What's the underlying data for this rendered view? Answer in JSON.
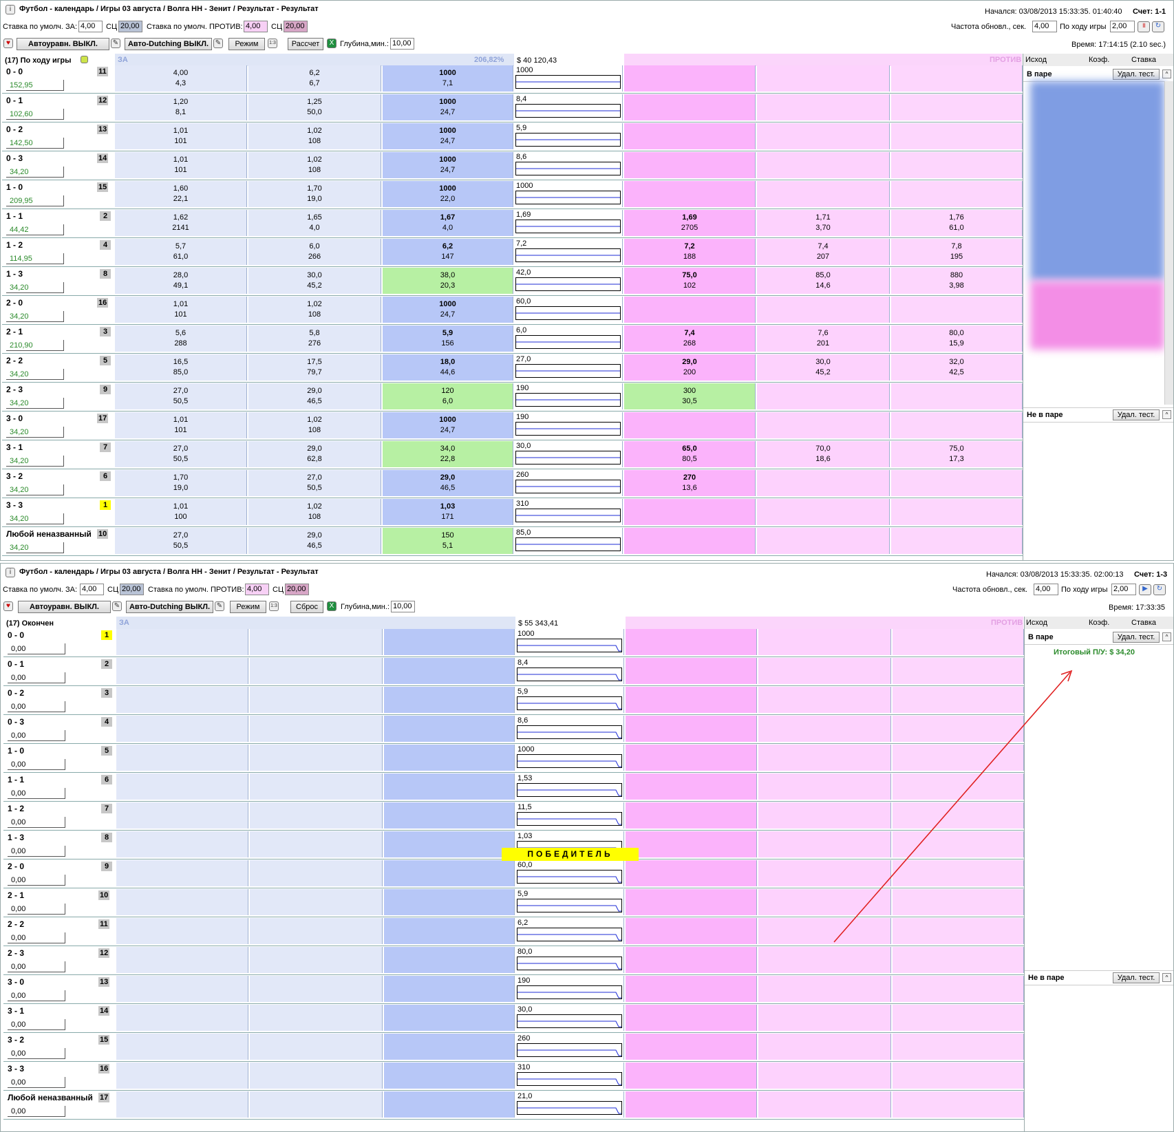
{
  "top": {
    "title": "Футбол - календарь / Игры 03 августа / Волга НН - Зенит / Результат - Результат",
    "started": "Начался: 03/08/2013 15:33:35. 01:40:40",
    "score": "Счет: 1-1",
    "stake_back_label": "Ставка по умолч. ЗА:",
    "stake_back": "4,00",
    "sc1_label": "СЦ",
    "sc1": "20,00",
    "stake_lay_label": "Ставка по умолч. ПРОТИВ:",
    "stake_lay": "4,00",
    "sc2_label": "СЦ",
    "sc2": "20,00",
    "refresh_label": "Частота обновл., сек.",
    "refresh": "4,00",
    "inplay_label": "По ходу игры",
    "inplay": "2,00",
    "auto_eq": "Автоуравн. ВЫКЛ.",
    "auto_dutch": "Авто-Dutching ВЫКЛ.",
    "mode": "Режим",
    "calc": "Рассчет",
    "depth_label": "Глубина,мин.:",
    "depth": "10,00",
    "time": "Время: 17:14:15 (2.10 sec.)",
    "market_name": "(17) По ходу игры",
    "za": "ЗА",
    "pct": "206,82%",
    "money": "$ 40 120,43",
    "protiv": "ПРОТИВ",
    "side_outcome": "Исход",
    "side_coef": "Коэф.",
    "side_stake": "Ставка",
    "matched": "В паре",
    "unmatched": "Не в паре",
    "del_btn": "Удал. тест.",
    "rows": [
      {
        "name": "0 - 0",
        "num": "11",
        "pl": "152,95",
        "b1": [
          "4,00",
          "4,3"
        ],
        "b2": [
          "6,2",
          "6,7"
        ],
        "b3": [
          "1000",
          "7,1"
        ],
        "ch": "1000",
        "l1": [
          "",
          ""
        ],
        "l2": [
          "",
          ""
        ],
        "l3": [
          "",
          ""
        ],
        "hl": false
      },
      {
        "name": "0 - 1",
        "num": "12",
        "pl": "102,60",
        "b1": [
          "1,20",
          "8,1"
        ],
        "b2": [
          "1,25",
          "50,0"
        ],
        "b3": [
          "1000",
          "24,7"
        ],
        "ch": "8,4",
        "l1": [
          "",
          ""
        ],
        "l2": [
          "",
          ""
        ],
        "l3": [
          "",
          ""
        ],
        "hl": false
      },
      {
        "name": "0 - 2",
        "num": "13",
        "pl": "142,50",
        "b1": [
          "1,01",
          "101"
        ],
        "b2": [
          "1,02",
          "108"
        ],
        "b3": [
          "1000",
          "24,7"
        ],
        "ch": "5,9",
        "l1": [
          "",
          ""
        ],
        "l2": [
          "",
          ""
        ],
        "l3": [
          "",
          ""
        ],
        "hl": false
      },
      {
        "name": "0 - 3",
        "num": "14",
        "pl": "34,20",
        "b1": [
          "1,01",
          "101"
        ],
        "b2": [
          "1,02",
          "108"
        ],
        "b3": [
          "1000",
          "24,7"
        ],
        "ch": "8,6",
        "l1": [
          "",
          ""
        ],
        "l2": [
          "",
          ""
        ],
        "l3": [
          "",
          ""
        ],
        "hl": false
      },
      {
        "name": "1 - 0",
        "num": "15",
        "pl": "209,95",
        "b1": [
          "1,60",
          "22,1"
        ],
        "b2": [
          "1,70",
          "19,0"
        ],
        "b3": [
          "1000",
          "22,0"
        ],
        "ch": "1000",
        "l1": [
          "",
          ""
        ],
        "l2": [
          "",
          ""
        ],
        "l3": [
          "",
          ""
        ],
        "hl": false
      },
      {
        "name": "1 - 1",
        "num": "2",
        "pl": "44,42",
        "b1": [
          "1,62",
          "2141"
        ],
        "b2": [
          "1,65",
          "4,0"
        ],
        "b3": [
          "1,67",
          "4,0"
        ],
        "ch": "1,69",
        "l1": [
          "1,69",
          "2705"
        ],
        "l2": [
          "1,71",
          "3,70"
        ],
        "l3": [
          "1,76",
          "61,0"
        ],
        "hl": false
      },
      {
        "name": "1 - 2",
        "num": "4",
        "pl": "114,95",
        "b1": [
          "5,7",
          "61,0"
        ],
        "b2": [
          "6,0",
          "266"
        ],
        "b3": [
          "6,2",
          "147"
        ],
        "ch": "7,2",
        "l1": [
          "7,2",
          "188"
        ],
        "l2": [
          "7,4",
          "207"
        ],
        "l3": [
          "7,8",
          "195"
        ],
        "hl": false
      },
      {
        "name": "1 - 3",
        "num": "8",
        "pl": "34,20",
        "b1": [
          "28,0",
          "49,1"
        ],
        "b2": [
          "30,0",
          "45,2"
        ],
        "b3": [
          "38,0",
          "20,3"
        ],
        "ch": "42,0",
        "l1": [
          "75,0",
          "102"
        ],
        "l2": [
          "85,0",
          "14,6"
        ],
        "l3": [
          "880",
          "3,98"
        ],
        "hl": true
      },
      {
        "name": "2 - 0",
        "num": "16",
        "pl": "34,20",
        "b1": [
          "1,01",
          "101"
        ],
        "b2": [
          "1,02",
          "108"
        ],
        "b3": [
          "1000",
          "24,7"
        ],
        "ch": "60,0",
        "l1": [
          "",
          ""
        ],
        "l2": [
          "",
          ""
        ],
        "l3": [
          "",
          ""
        ],
        "hl": false
      },
      {
        "name": "2 - 1",
        "num": "3",
        "pl": "210,90",
        "b1": [
          "5,6",
          "288"
        ],
        "b2": [
          "5,8",
          "276"
        ],
        "b3": [
          "5,9",
          "156"
        ],
        "ch": "6,0",
        "l1": [
          "7,4",
          "268"
        ],
        "l2": [
          "7,6",
          "201"
        ],
        "l3": [
          "80,0",
          "15,9"
        ],
        "hl": false
      },
      {
        "name": "2 - 2",
        "num": "5",
        "pl": "34,20",
        "b1": [
          "16,5",
          "85,0"
        ],
        "b2": [
          "17,5",
          "79,7"
        ],
        "b3": [
          "18,0",
          "44,6"
        ],
        "ch": "27,0",
        "l1": [
          "29,0",
          "200"
        ],
        "l2": [
          "30,0",
          "45,2"
        ],
        "l3": [
          "32,0",
          "42,5"
        ],
        "hl": false
      },
      {
        "name": "2 - 3",
        "num": "9",
        "pl": "34,20",
        "b1": [
          "27,0",
          "50,5"
        ],
        "b2": [
          "29,0",
          "46,5"
        ],
        "b3": [
          "120",
          "6,0"
        ],
        "ch": "190",
        "l1": [
          "300",
          "30,5"
        ],
        "l2": [
          "",
          ""
        ],
        "l3": [
          "",
          ""
        ],
        "hl": true,
        "hl_lay": true
      },
      {
        "name": "3 - 0",
        "num": "17",
        "pl": "34,20",
        "b1": [
          "1,01",
          "101"
        ],
        "b2": [
          "1,02",
          "108"
        ],
        "b3": [
          "1000",
          "24,7"
        ],
        "ch": "190",
        "l1": [
          "",
          ""
        ],
        "l2": [
          "",
          ""
        ],
        "l3": [
          "",
          ""
        ],
        "hl": false
      },
      {
        "name": "3 - 1",
        "num": "7",
        "pl": "34,20",
        "b1": [
          "27,0",
          "50,5"
        ],
        "b2": [
          "29,0",
          "62,8"
        ],
        "b3": [
          "34,0",
          "22,8"
        ],
        "ch": "30,0",
        "l1": [
          "65,0",
          "80,5"
        ],
        "l2": [
          "70,0",
          "18,6"
        ],
        "l3": [
          "75,0",
          "17,3"
        ],
        "hl": true
      },
      {
        "name": "3 - 2",
        "num": "6",
        "pl": "34,20",
        "b1": [
          "1,70",
          "19,0"
        ],
        "b2": [
          "27,0",
          "50,5"
        ],
        "b3": [
          "29,0",
          "46,5"
        ],
        "ch": "260",
        "l1": [
          "270",
          "13,6"
        ],
        "l2": [
          "",
          ""
        ],
        "l3": [
          "",
          ""
        ],
        "hl": false
      },
      {
        "name": "3 - 3",
        "num": "1",
        "pl": "34,20",
        "b1": [
          "1,01",
          "100"
        ],
        "b2": [
          "1,02",
          "108"
        ],
        "b3": [
          "1,03",
          "171"
        ],
        "ch": "310",
        "l1": [
          "",
          ""
        ],
        "l2": [
          "",
          ""
        ],
        "l3": [
          "",
          ""
        ],
        "hl": false,
        "yel": true
      },
      {
        "name": "Любой неназванный",
        "num": "10",
        "pl": "34,20",
        "b1": [
          "27,0",
          "50,5"
        ],
        "b2": [
          "29,0",
          "46,5"
        ],
        "b3": [
          "150",
          "5,1"
        ],
        "ch": "85,0",
        "l1": [
          "",
          ""
        ],
        "l2": [
          "",
          ""
        ],
        "l3": [
          "",
          ""
        ],
        "hl": true
      }
    ]
  },
  "bottom": {
    "title": "Футбол - календарь / Игры 03 августа / Волга НН - Зенит / Результат - Результат",
    "started": "Начался: 03/08/2013 15:33:35. 02:00:13",
    "score": "Счет: 1-3",
    "stake_back_label": "Ставка по умолч. ЗА:",
    "stake_back": "4,00",
    "sc1_label": "СЦ",
    "sc1": "20,00",
    "stake_lay_label": "Ставка по умолч. ПРОТИВ:",
    "stake_lay": "4,00",
    "sc2_label": "СЦ",
    "sc2": "20,00",
    "refresh_label": "Частота обновл., сек.",
    "refresh": "4,00",
    "inplay_label": "По ходу игры",
    "inplay": "2,00",
    "auto_eq": "Автоуравн. ВЫКЛ.",
    "auto_dutch": "Авто-Dutching ВЫКЛ.",
    "mode": "Режим",
    "reset": "Сброс",
    "depth_label": "Глубина,мин.:",
    "depth": "10,00",
    "time": "Время: 17:33:35",
    "market_name": "(17) Окончен",
    "za": "ЗА",
    "money": "$ 55 343,41",
    "protiv": "ПРОТИВ",
    "side_outcome": "Исход",
    "side_coef": "Коэф.",
    "side_stake": "Ставка",
    "matched": "В паре",
    "unmatched": "Не в паре",
    "del_btn": "Удал. тест.",
    "total_pl": "Итоговый П/У: $ 34,20",
    "winner": "ПОБЕДИТЕЛЬ",
    "rows": [
      {
        "name": "0 - 0",
        "num": "1",
        "pl": "0,00",
        "ch": "1000",
        "yel": true
      },
      {
        "name": "0 - 1",
        "num": "2",
        "pl": "0,00",
        "ch": "8,4"
      },
      {
        "name": "0 - 2",
        "num": "3",
        "pl": "0,00",
        "ch": "5,9"
      },
      {
        "name": "0 - 3",
        "num": "4",
        "pl": "0,00",
        "ch": "8,6"
      },
      {
        "name": "1 - 0",
        "num": "5",
        "pl": "0,00",
        "ch": "1000"
      },
      {
        "name": "1 - 1",
        "num": "6",
        "pl": "0,00",
        "ch": "1,53"
      },
      {
        "name": "1 - 2",
        "num": "7",
        "pl": "0,00",
        "ch": "11,5"
      },
      {
        "name": "1 - 3",
        "num": "8",
        "pl": "0,00",
        "ch": "1,03"
      },
      {
        "name": "2 - 0",
        "num": "9",
        "pl": "0,00",
        "ch": "60,0"
      },
      {
        "name": "2 - 1",
        "num": "10",
        "pl": "0,00",
        "ch": "5,9"
      },
      {
        "name": "2 - 2",
        "num": "11",
        "pl": "0,00",
        "ch": "6,2"
      },
      {
        "name": "2 - 3",
        "num": "12",
        "pl": "0,00",
        "ch": "80,0"
      },
      {
        "name": "3 - 0",
        "num": "13",
        "pl": "0,00",
        "ch": "190"
      },
      {
        "name": "3 - 1",
        "num": "14",
        "pl": "0,00",
        "ch": "30,0"
      },
      {
        "name": "3 - 2",
        "num": "15",
        "pl": "0,00",
        "ch": "260"
      },
      {
        "name": "3 - 3",
        "num": "16",
        "pl": "0,00",
        "ch": "310"
      },
      {
        "name": "Любой неназванный",
        "num": "17",
        "pl": "0,00",
        "ch": "21,0"
      }
    ]
  },
  "colors": {
    "za_band": "#dfe6f6",
    "back_best": "#b7c7f7",
    "lay_best": "#fbb3fb",
    "matched_green": "#b7f0a3",
    "arrow": "#e02020"
  }
}
